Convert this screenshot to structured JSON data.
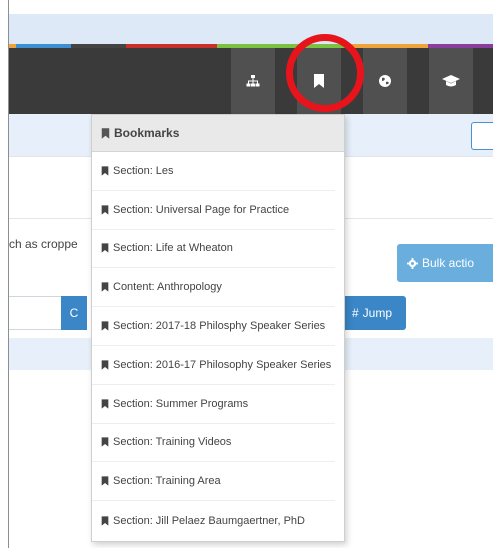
{
  "colors": {
    "nav_bg": "#3a3a3a",
    "nav_button": "#505050",
    "highlight": "#e8141c",
    "accent_blue": "#3b86c6",
    "bulk_blue": "#6aaede",
    "light_band": "#e7f0fa"
  },
  "nav": {
    "icons": [
      "sitemap-icon",
      "bookmark-icon",
      "globe-icon",
      "graduation-cap-icon"
    ]
  },
  "background": {
    "crop_text": "ch as croppe",
    "bulk_button": "Bulk actio",
    "search_button": "C",
    "jump_button": "Jump"
  },
  "bookmarks": {
    "title": "Bookmarks",
    "items": [
      {
        "label": "Section: Les"
      },
      {
        "label": "Section: Universal Page for Practice"
      },
      {
        "label": "Section: Life at Wheaton"
      },
      {
        "label": "Content: Anthropology"
      },
      {
        "label": "Section: 2017-18 Philosphy Speaker Series"
      },
      {
        "label": "Section: 2016-17 Philosophy Speaker Series"
      },
      {
        "label": "Section: Summer Programs"
      },
      {
        "label": "Section: Training Videos"
      },
      {
        "label": "Section: Training Area"
      },
      {
        "label": "Section: Jill Pelaez Baumgaertner, PhD"
      }
    ]
  }
}
